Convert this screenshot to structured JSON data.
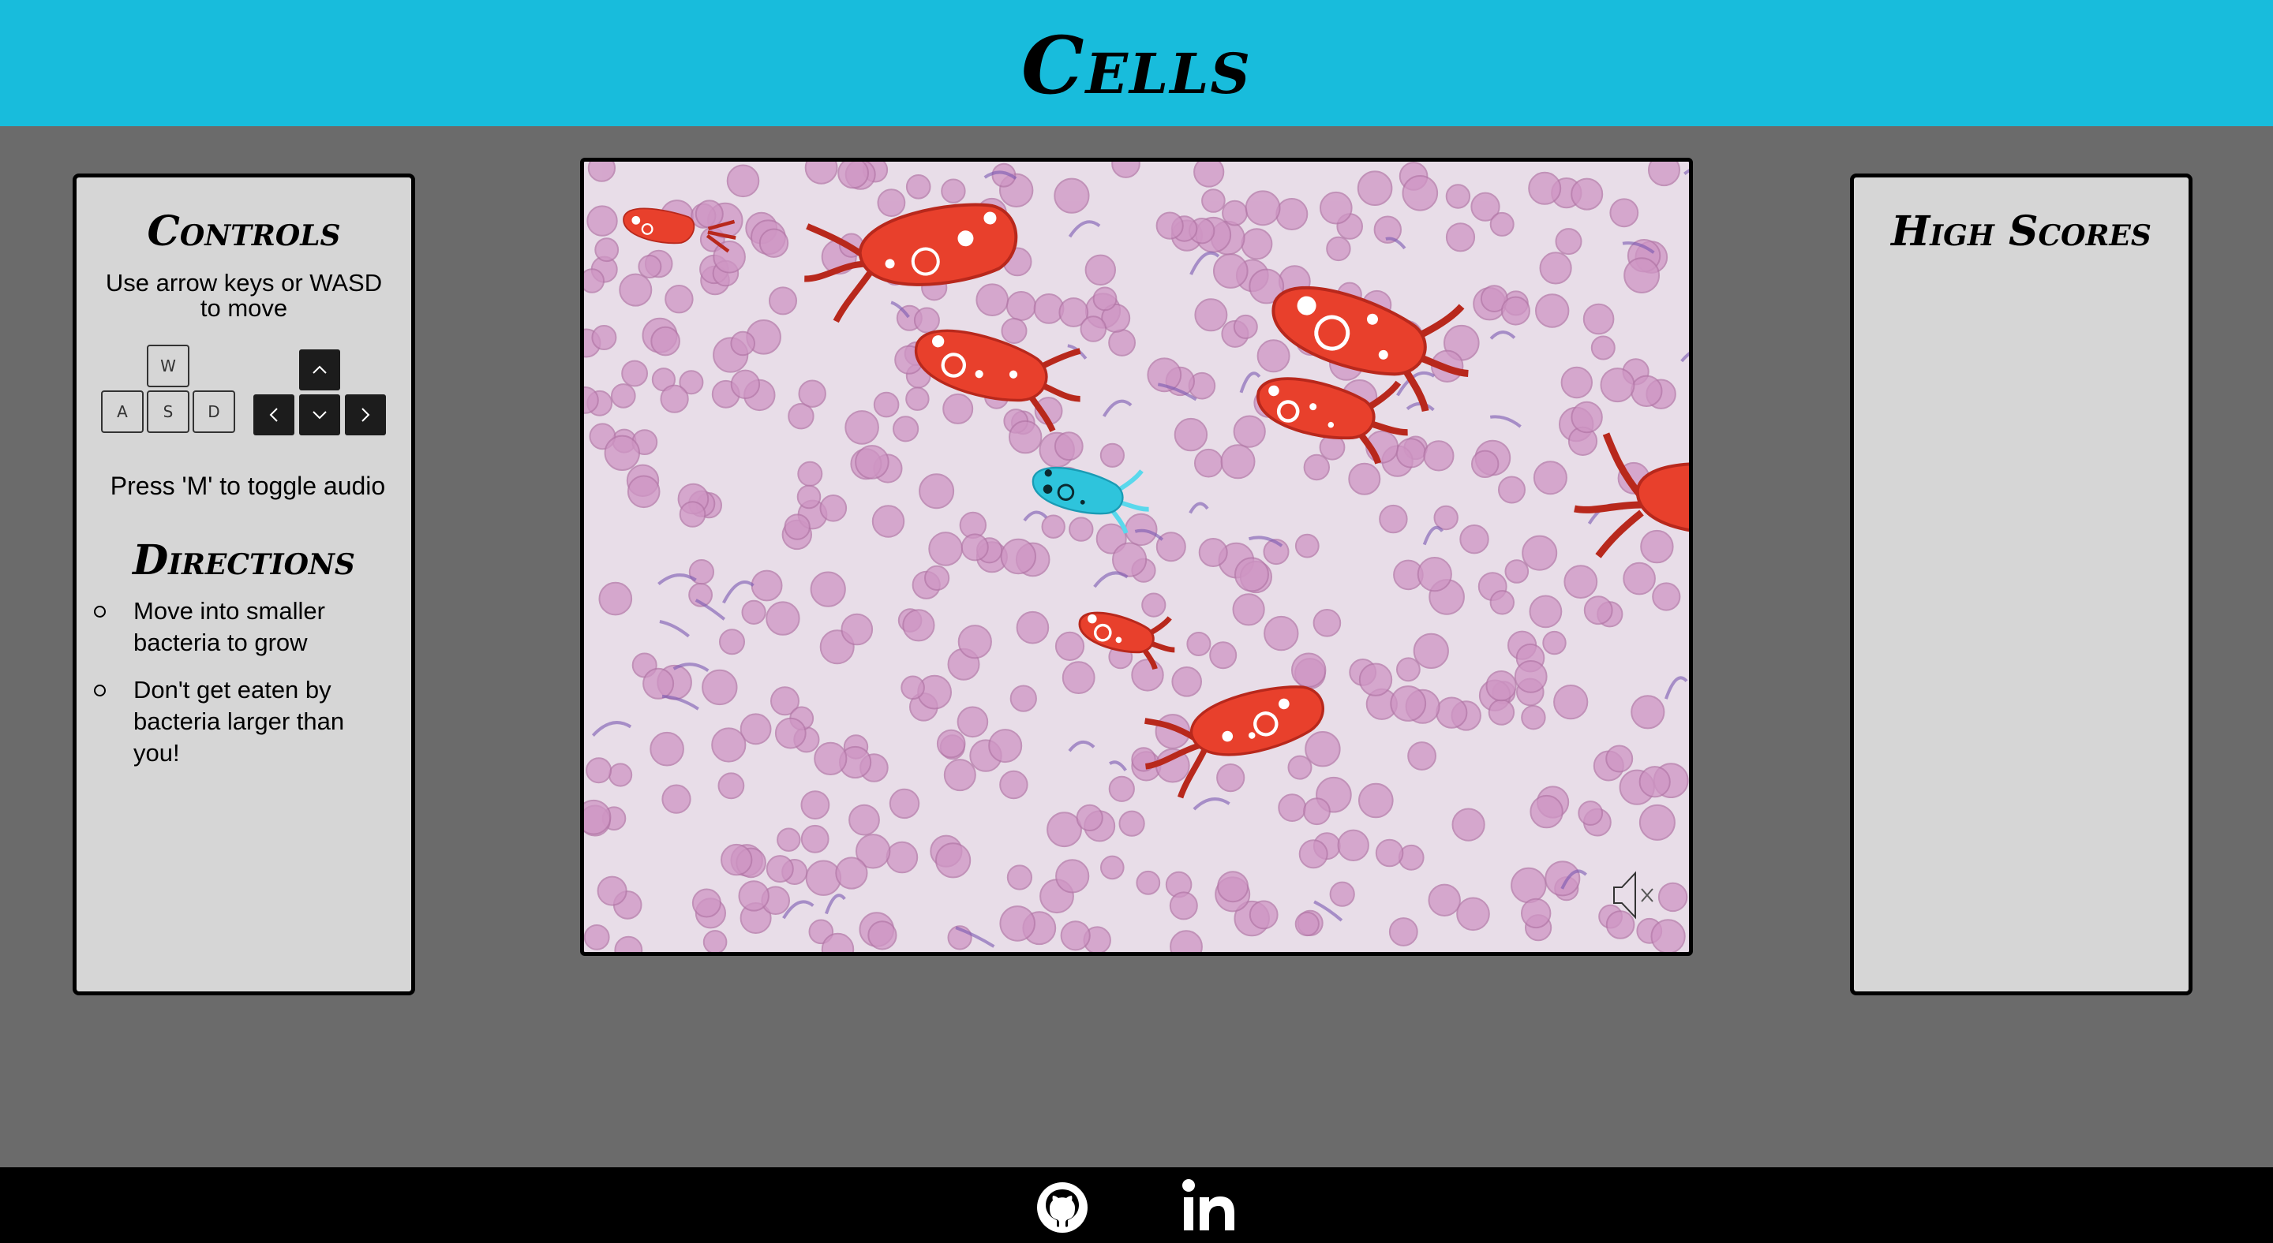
{
  "header": {
    "title": "Cells"
  },
  "controls": {
    "heading": "Controls",
    "move_text": "Use arrow keys or WASD to move",
    "keys": {
      "w": "W",
      "a": "A",
      "s": "S",
      "d": "D"
    },
    "audio_text": "Press 'M' to toggle audio"
  },
  "directions": {
    "heading": "Directions",
    "items": [
      "Move into smaller bacteria to grow",
      "Don't get eaten by bacteria larger than you!"
    ]
  },
  "high_scores": {
    "heading": "High Scores"
  },
  "game": {
    "mute_state": "muted",
    "colors": {
      "enemy": "#e8402c",
      "player": "#2ec4dc",
      "flagella_enemy": "#b8281c",
      "flagella_player": "#5ad8ec",
      "background": "#e8dde8",
      "blood_cell": "#c88cbc"
    }
  },
  "footer": {
    "icons": [
      "github-icon",
      "linkedin-icon"
    ]
  },
  "colors": {
    "header_bg": "#18bcdc",
    "page_bg": "#6b6b6b",
    "panel_bg": "#d6d6d6",
    "footer_bg": "#000000"
  }
}
